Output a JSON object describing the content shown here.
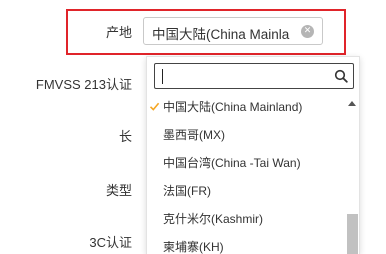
{
  "form": {
    "labels": {
      "origin": "产地",
      "fmvss": "FMVSS 213认证",
      "length": "长",
      "type": "类型",
      "ccc": "3C认证"
    },
    "origin_select": {
      "value": "中国大陆(China Mainland)",
      "clear_icon": "clear-icon"
    }
  },
  "dropdown": {
    "search": {
      "value": "",
      "icon": "search-icon"
    },
    "options": [
      {
        "label": "中国大陆(China Mainland)",
        "selected": true
      },
      {
        "label": "墨西哥(MX)",
        "selected": false
      },
      {
        "label": "中国台湾(China -Tai Wan)",
        "selected": false
      },
      {
        "label": "法国(FR)",
        "selected": false
      },
      {
        "label": "克什米尔(Kashmir)",
        "selected": false
      },
      {
        "label": "柬埔寨(KH)",
        "selected": false
      }
    ]
  },
  "colors": {
    "highlight": "#e0242a",
    "check": "#f5a623"
  }
}
